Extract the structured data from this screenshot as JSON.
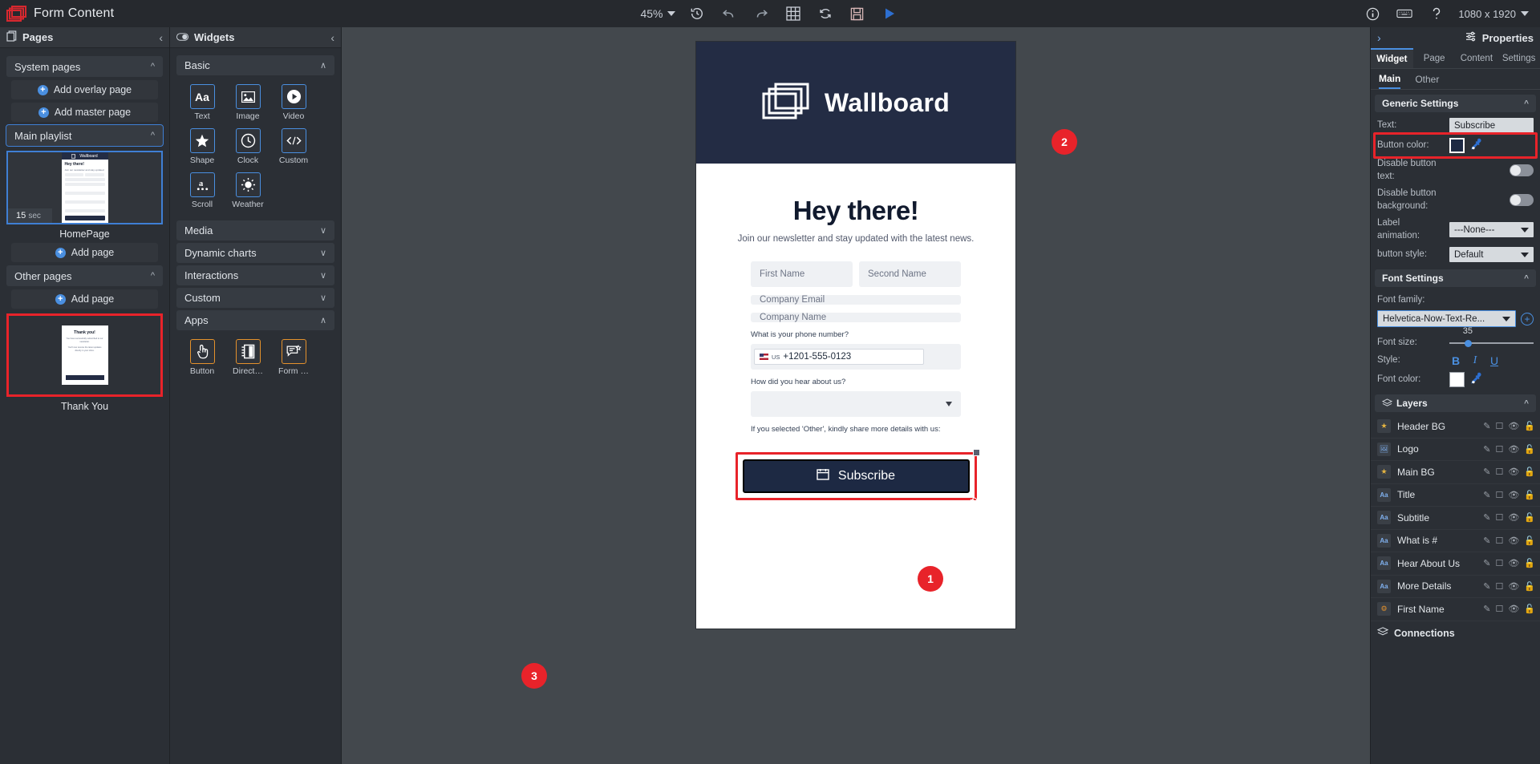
{
  "topbar": {
    "app_title": "Form Content",
    "zoom_level": "45%",
    "resolution": "1080 x 1920",
    "icons": [
      "history-icon",
      "undo-icon",
      "redo-icon",
      "grid-icon",
      "refresh-icon",
      "save-icon",
      "play-icon"
    ],
    "right_icons": [
      "info-icon",
      "keyboard-icon",
      "help-icon"
    ]
  },
  "pages_panel": {
    "title": "Pages",
    "collapse": "‹",
    "system_pages_label": "System pages",
    "add_overlay_page": "Add overlay page",
    "add_master_page": "Add master page",
    "main_playlist_label": "Main playlist",
    "add_page_1": "Add page",
    "other_pages_label": "Other pages",
    "add_page_2": "Add page",
    "home_page": {
      "caption": "HomePage",
      "duration": "15",
      "duration_unit": "sec"
    },
    "thank_you_page": {
      "caption": "Thank You"
    },
    "thumb_home": {
      "brand": "Wallboard",
      "title": "Hey there!",
      "subtitle": "Join our newsletter and stay updated",
      "btn": "Subscribe"
    },
    "thumb_thanks": {
      "title": "Thank you!",
      "p1": "You have successfully subscribed to our newsletter.",
      "p2": "You'll now receive the latest updates directly in your inbox."
    }
  },
  "widgets_panel": {
    "title": "Widgets",
    "collapse": "‹",
    "sections": [
      {
        "label": "Basic",
        "chev": "∧"
      },
      {
        "label": "Media",
        "chev": "∨"
      },
      {
        "label": "Dynamic charts",
        "chev": "∨"
      },
      {
        "label": "Interactions",
        "chev": "∨"
      },
      {
        "label": "Custom",
        "chev": "∨"
      },
      {
        "label": "Apps",
        "chev": "∧"
      }
    ],
    "basic_widgets": [
      {
        "label": "Text",
        "icon": "text-aa-icon"
      },
      {
        "label": "Image",
        "icon": "image-icon"
      },
      {
        "label": "Video",
        "icon": "video-play-icon"
      },
      {
        "label": "Shape",
        "icon": "star-shape-icon"
      },
      {
        "label": "Clock",
        "icon": "clock-icon"
      },
      {
        "label": "Custom",
        "icon": "code-icon"
      },
      {
        "label": "Scroll",
        "icon": "scroll-text-icon"
      },
      {
        "label": "Weather",
        "icon": "weather-sun-icon"
      }
    ],
    "app_widgets": [
      {
        "label": "Button",
        "icon": "button-tap-icon"
      },
      {
        "label": "Direct…",
        "icon": "directory-icon"
      },
      {
        "label": "Form …",
        "icon": "form-icon"
      }
    ]
  },
  "canvas": {
    "header_brand": "Wallboard",
    "heading": "Hey there!",
    "subheading": "Join our newsletter and stay updated with the latest news.",
    "first_name_placeholder": "First Name",
    "second_name_placeholder": "Second Name",
    "company_email_placeholder": "Company Email",
    "company_name_placeholder": "Company Name",
    "phone_label": "What is your phone number?",
    "phone_country": "US",
    "phone_value": "+1201-555-0123",
    "hear_label": "How did you hear about us?",
    "hear_value": "",
    "other_label": "If you selected 'Other', kindly share more details with us:",
    "other_value": "",
    "subscribe_label": "Subscribe"
  },
  "callouts": [
    {
      "number": "1"
    },
    {
      "number": "2"
    },
    {
      "number": "3"
    }
  ],
  "properties": {
    "title": "Properties",
    "expand": "›",
    "main_tabs": [
      {
        "label": "Widget",
        "active": true
      },
      {
        "label": "Page",
        "active": false
      },
      {
        "label": "Content",
        "active": false
      },
      {
        "label": "Settings",
        "active": false
      }
    ],
    "sub_tabs": [
      {
        "label": "Main",
        "active": true
      },
      {
        "label": "Other",
        "active": false
      }
    ],
    "generic_settings": {
      "group_label": "Generic Settings",
      "text_label": "Text:",
      "text_value": "Subscribe",
      "button_color_label": "Button color:",
      "button_color_value": "#1d2943",
      "disable_button_text_label": "Disable button text:",
      "disable_button_text_on": false,
      "disable_button_bg_label": "Disable button background:",
      "disable_button_bg_on": false,
      "label_animation_label": "Label animation:",
      "label_animation_value": "---None---",
      "button_style_label": "button style:",
      "button_style_value": "Default"
    },
    "font_settings": {
      "group_label": "Font Settings",
      "font_family_label": "Font family:",
      "font_family_value": "Helvetica-Now-Text-Re...",
      "font_size_label": "Font size:",
      "font_size_value": "35",
      "style_label": "Style:",
      "style_buttons": [
        "B",
        "I",
        "U"
      ],
      "font_color_label": "Font color:",
      "font_color_value": "#ffffff"
    },
    "layers": {
      "group_label": "Layers",
      "items": [
        {
          "name": "Header BG",
          "icon": "star-icon"
        },
        {
          "name": "Logo",
          "icon": "image-icon"
        },
        {
          "name": "Main BG",
          "icon": "star-icon"
        },
        {
          "name": "Title",
          "icon": "text-icon"
        },
        {
          "name": "Subtitle",
          "icon": "text-icon"
        },
        {
          "name": "What is #",
          "icon": "text-icon"
        },
        {
          "name": "Hear About Us",
          "icon": "text-icon"
        },
        {
          "name": "More Details",
          "icon": "text-icon"
        },
        {
          "name": "First Name",
          "icon": "form-icon"
        }
      ],
      "action_icons": [
        "edit-pencil-icon",
        "duplicate-icon",
        "visibility-eye-icon",
        "lock-icon"
      ]
    },
    "connections_label": "Connections"
  }
}
